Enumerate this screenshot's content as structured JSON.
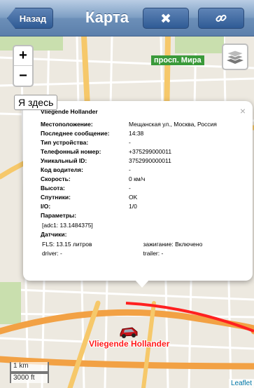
{
  "navbar": {
    "back_label": "Назад",
    "title": "Карта",
    "left_action_icon": "satellite-icon",
    "right_action_icon": "link-icon"
  },
  "map": {
    "zoom_in": "+",
    "zoom_out": "−",
    "street_label": "просп. Мира",
    "here_label": "Я здесь",
    "scale_km": "1 km",
    "scale_ft": "3000 ft",
    "attribution": "Leaflet",
    "vehicle_label": "Vliegende Hollander",
    "route_color": "#ff2020"
  },
  "popup": {
    "close": "×",
    "title": "Vliegende Hollander",
    "rows": [
      {
        "key": "Местоположение:",
        "value": "Мещанская ул., Москва, Россия"
      },
      {
        "key": "Последнее сообщение:",
        "value": "14:38"
      },
      {
        "key": "Тип устройства:",
        "value": "-"
      },
      {
        "key": "Телефонный номер:",
        "value": "+375299000011"
      },
      {
        "key": "Уникальный ID:",
        "value": "3752990000011"
      },
      {
        "key": "Код водителя:",
        "value": "-"
      },
      {
        "key": "Скорость:",
        "value": "0 км/ч"
      },
      {
        "key": "Высота:",
        "value": "-"
      },
      {
        "key": "Спутники:",
        "value": "OK"
      },
      {
        "key": "I/O:",
        "value": "1/0"
      }
    ],
    "params_title": "Параметры:",
    "params_value": "[adc1: 13.1484375]",
    "sensors_title": "Датчики:",
    "sensors": [
      {
        "left": "FLS: 13.15 литров",
        "right": "зажигание: Включено"
      },
      {
        "left": "driver: -",
        "right": "trailer: -"
      }
    ]
  }
}
